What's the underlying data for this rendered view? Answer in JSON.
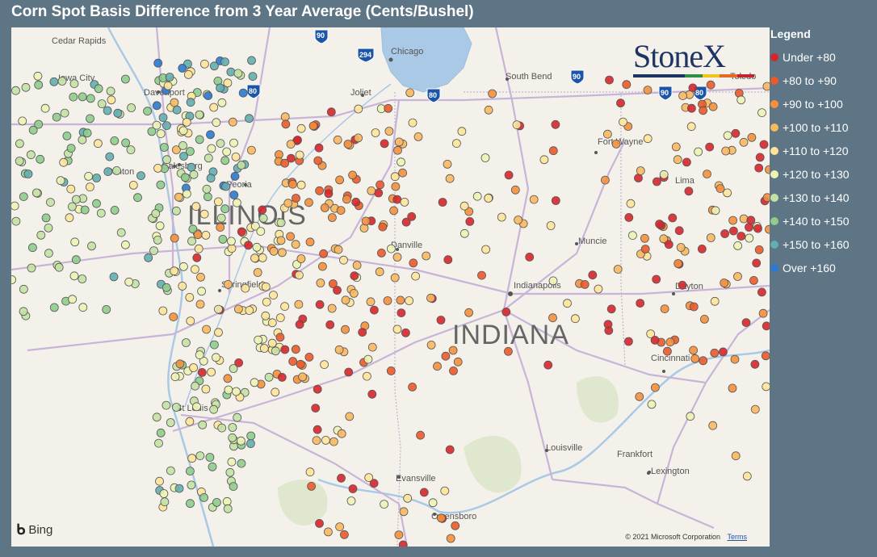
{
  "title": "Corn Spot Basis Difference from 3 Year Average (Cents/Bushel)",
  "legend": {
    "title": "Legend",
    "items": [
      {
        "label": "Under +80",
        "color": "#d7262b"
      },
      {
        "label": "+80 to +90",
        "color": "#ec5a2a"
      },
      {
        "label": "+90 to +100",
        "color": "#f4903d"
      },
      {
        "label": "+100 to +110",
        "color": "#f8b860"
      },
      {
        "label": "+110 to +120",
        "color": "#fde49a"
      },
      {
        "label": "+120 to +130",
        "color": "#edf3b4"
      },
      {
        "label": "+130 to +140",
        "color": "#c4e2a4"
      },
      {
        "label": "+140 to +150",
        "color": "#8fcc8d"
      },
      {
        "label": "+150 to +160",
        "color": "#63aeb0"
      },
      {
        "label": "Over +160",
        "color": "#2b7ad0"
      }
    ]
  },
  "map": {
    "states": [
      "ILLINOIS",
      "INDIANA"
    ],
    "cities": [
      "Cedar Rapids",
      "Iowa City",
      "Davenport",
      "Galesburg",
      "Peoria",
      "Springfield",
      "St Louis",
      "Chicago",
      "Joliet",
      "Danville",
      "Indianapolis",
      "Muncie",
      "Fort Wayne",
      "South Bend",
      "Toledo",
      "Lima",
      "Dayton",
      "Cincinnati",
      "Louisville",
      "Evansville",
      "Owensboro",
      "Frankfort",
      "Lexington",
      "Clinton"
    ],
    "highways": [
      "90",
      "294",
      "80",
      "90",
      "80",
      "90",
      "80"
    ],
    "attribution": "© 2021 Microsoft Corporation",
    "terms_link": "Terms",
    "provider": "Bing"
  },
  "logo": {
    "text": "StoneX",
    "trademark": "™",
    "bar_colors": [
      "#1e3564",
      "#2f8f46",
      "#f0c419",
      "#e46b26",
      "#c0262d"
    ]
  }
}
